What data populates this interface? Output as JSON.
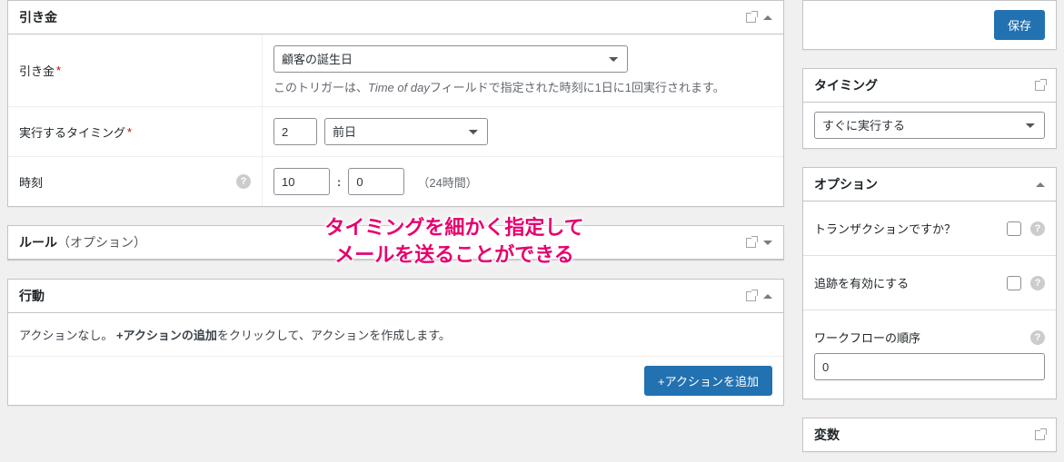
{
  "trigger": {
    "panel_title": "引き金",
    "label": "引き金",
    "select_value": "顧客の誕生日",
    "description_prefix": "このトリガーは、",
    "description_em": "Time of day",
    "description_suffix": "フィールドで指定された時刻に1日に1回実行されます。",
    "timing_label": "実行するタイミング",
    "timing_number": "2",
    "timing_unit": "前日",
    "time_label": "時刻",
    "time_hour": "10",
    "time_minute": "0",
    "time_hint": "（24時間）"
  },
  "rules": {
    "panel_title": "ルール",
    "panel_subtitle": "（オプション）"
  },
  "actions": {
    "panel_title": "行動",
    "empty_prefix": "アクションなし。 ",
    "empty_strong": "+アクションの追加",
    "empty_suffix": "をクリックして、アクションを作成します。",
    "add_button": "+アクションを追加"
  },
  "side": {
    "save_button": "保存",
    "timing": {
      "title": "タイミング",
      "select_value": "すぐに実行する"
    },
    "options": {
      "title": "オプション",
      "transactional_label": "トランザクションですか？",
      "tracking_label": "追跡を有効にする",
      "order_label": "ワークフローの順序",
      "order_value": "0"
    },
    "variables": {
      "title": "変数"
    }
  },
  "overlay": {
    "line1": "タイミングを細かく指定して",
    "line2": "メールを送ることができる"
  }
}
